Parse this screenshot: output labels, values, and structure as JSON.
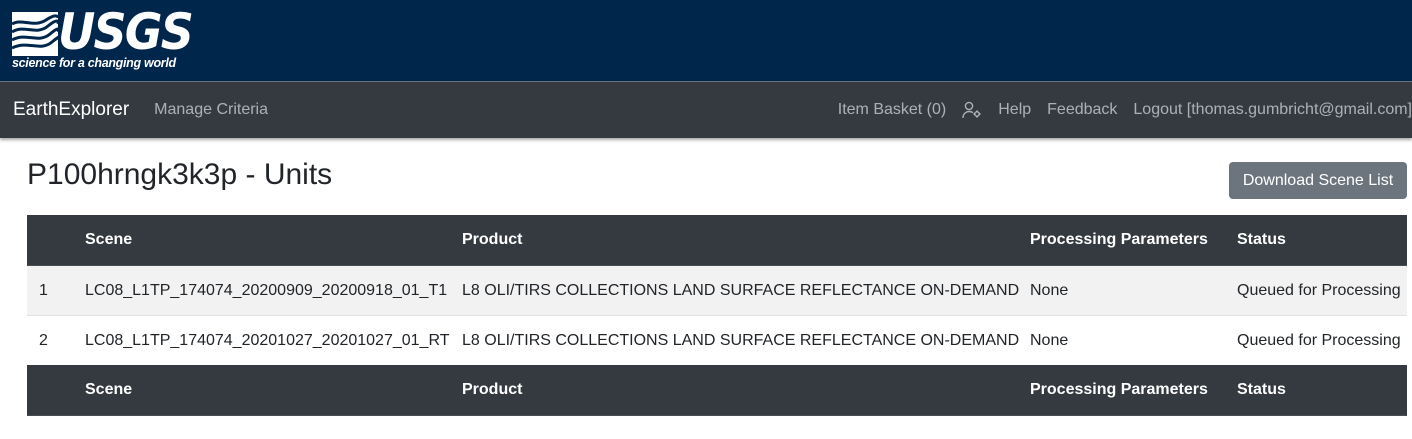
{
  "logo": {
    "wordmark": "USGS",
    "tagline": "science for a changing world"
  },
  "navbar": {
    "brand": "EarthExplorer",
    "manage_criteria": "Manage Criteria",
    "item_basket": "Item Basket (0)",
    "user_icon": "user-settings-icon",
    "help": "Help",
    "feedback": "Feedback",
    "logout": "Logout [thomas.gumbricht@gmail.com]"
  },
  "page": {
    "title": "P100hrngk3k3p - Units",
    "download_button": "Download Scene List"
  },
  "table": {
    "headers": [
      "",
      "Scene",
      "Product",
      "Processing Parameters",
      "Status"
    ],
    "rows": [
      [
        "1",
        "LC08_L1TP_174074_20200909_20200918_01_T1",
        "L8 OLI/TIRS COLLECTIONS LAND SURFACE REFLECTANCE ON-DEMAND",
        "None",
        "Queued for Processing"
      ],
      [
        "2",
        "LC08_L1TP_174074_20201027_20201027_01_RT",
        "L8 OLI/TIRS COLLECTIONS LAND SURFACE REFLECTANCE ON-DEMAND",
        "None",
        "Queued for Processing"
      ]
    ]
  },
  "colors": {
    "usgs_blue": "#00264c",
    "navbar": "#343a40",
    "button_secondary": "#6c757d"
  }
}
